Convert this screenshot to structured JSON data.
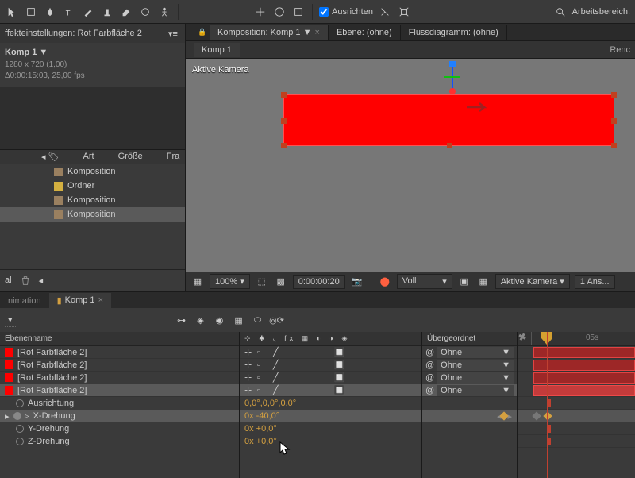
{
  "toolbar": {
    "align_label": "Ausrichten",
    "workspace_label": "Arbeitsbereich:"
  },
  "effects_panel": {
    "header": "ffekteinstellungen: Rot Farbfläche 2",
    "comp_title": "Komp 1 ▼",
    "comp_size": "1280 x 720 (1,00)",
    "comp_duration": "Δ0:00:15:03, 25,00 fps"
  },
  "project": {
    "cols": {
      "type": "Art",
      "size": "Größe",
      "fr": "Fra"
    },
    "items": [
      {
        "label": "Komposition",
        "color": "tan"
      },
      {
        "label": "Ordner",
        "color": "yellow"
      },
      {
        "label": "Komposition",
        "color": "tan"
      },
      {
        "label": "Komposition",
        "color": "tan",
        "selected": true
      }
    ],
    "footer_label": "al"
  },
  "viewer_tabs": {
    "comp": "Komposition: Komp 1 ▼",
    "layer": "Ebene: (ohne)",
    "flow": "Flussdiagramm: (ohne)"
  },
  "viewer": {
    "comp_tab": "Komp 1",
    "render": "Renc",
    "camera": "Aktive Kamera"
  },
  "viewer_footer": {
    "zoom": "100%",
    "time": "0:00:00:20",
    "res": "Voll",
    "camera": "Aktive Kamera",
    "views": "1 Ans..."
  },
  "timeline": {
    "tabs": {
      "anim": "nimation",
      "comp": "Komp 1"
    },
    "layer_col": "Ebenenname",
    "parent_col": "Übergeordnet",
    "layers": [
      "[Rot Farbfläche 2]",
      "[Rot Farbfläche 2]",
      "[Rot Farbfläche 2]",
      "[Rot Farbfläche 2]"
    ],
    "parent_value": "Ohne",
    "props": {
      "orientation": {
        "label": "Ausrichtung",
        "value": "0,0°,0,0°,0,0°"
      },
      "xrot": {
        "label": "X-Drehung",
        "value": "0x -40,0°"
      },
      "yrot": {
        "label": "Y-Drehung",
        "value": "0x +0,0°"
      },
      "zrot": {
        "label": "Z-Drehung",
        "value": "0x +0,0°"
      }
    },
    "ruler_mark": "05s"
  }
}
